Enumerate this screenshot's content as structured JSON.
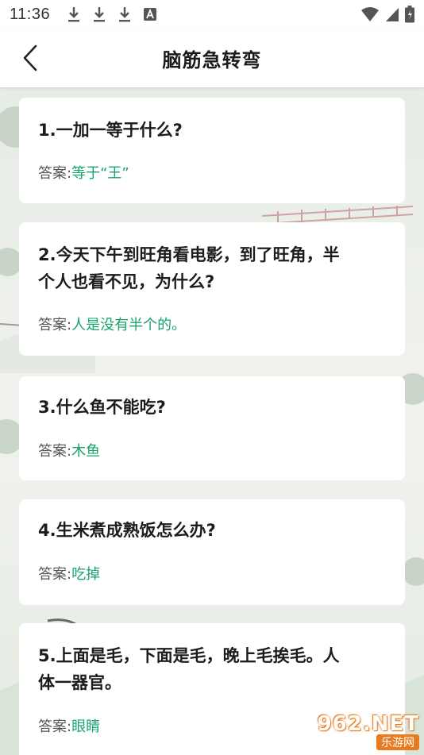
{
  "status": {
    "time": "11:36",
    "notification_icons": [
      "download-icon",
      "download-icon",
      "download-icon",
      "a-icon"
    ],
    "right_icons": [
      "wifi-icon",
      "signal-icon",
      "battery-icon"
    ]
  },
  "header": {
    "title": "脑筋急转弯",
    "back_icon": "chevron-left-icon"
  },
  "answer_label": "答案:",
  "items": [
    {
      "question": "1.一加一等于什么?",
      "answer": "等于“王”"
    },
    {
      "question_line1": "2.今天下午到旺角看电影，到了旺角，半",
      "question_line2": "个人也看不见，为什么?",
      "answer": "人是没有半个的。"
    },
    {
      "question": "3.什么鱼不能吃?",
      "answer": "木鱼"
    },
    {
      "question": "4.生米煮成熟饭怎么办?",
      "answer": "吃掉"
    },
    {
      "question_line1": "5.上面是毛，下面是毛，晚上毛挨毛。人",
      "question_line2": "体一器官。",
      "answer": "眼睛"
    }
  ],
  "watermark": {
    "main": "962.NET",
    "sub": "乐游网"
  },
  "colors": {
    "answer": "#18a36b",
    "accent_watermark": "#e87b1f"
  }
}
